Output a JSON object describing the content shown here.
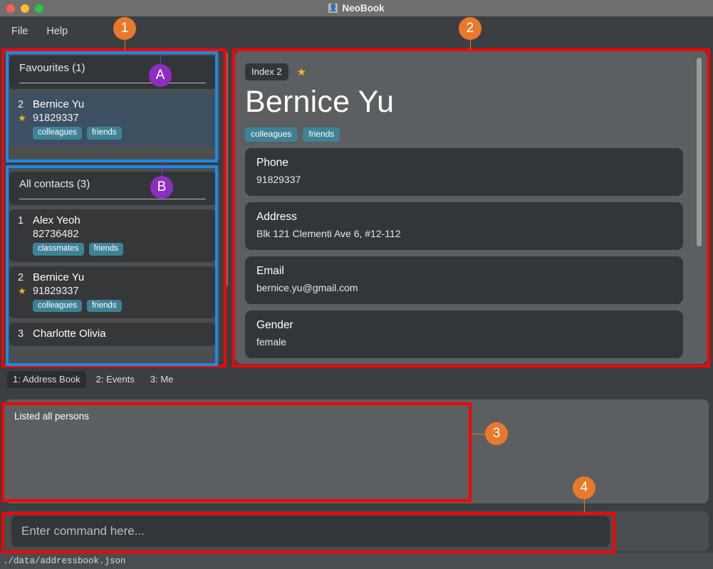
{
  "window": {
    "title": "NeoBook",
    "title_icon": "person-icon",
    "traffic_lights": [
      "close",
      "minimize",
      "maximize"
    ]
  },
  "menubar": {
    "items": [
      {
        "label": "File",
        "name": "menu-file"
      },
      {
        "label": "Help",
        "name": "menu-help"
      }
    ]
  },
  "favourites_panel": {
    "header": "Favourites (1)",
    "contacts": [
      {
        "index": "2",
        "name": "Bernice Yu",
        "phone": "91829337",
        "favourite": true,
        "star_glyph": "★",
        "tags": [
          "colleagues",
          "friends"
        ],
        "selected": true
      }
    ]
  },
  "all_contacts_panel": {
    "header": "All contacts (3)",
    "contacts": [
      {
        "index": "1",
        "name": "Alex Yeoh",
        "phone": "82736482",
        "favourite": false,
        "star_glyph": "★",
        "tags": [
          "classmates",
          "friends"
        ],
        "selected": false
      },
      {
        "index": "2",
        "name": "Bernice Yu",
        "phone": "91829337",
        "favourite": true,
        "star_glyph": "★",
        "tags": [
          "colleagues",
          "friends"
        ],
        "selected": false
      },
      {
        "index": "3",
        "name": "Charlotte Olivia",
        "phone": "",
        "favourite": false,
        "star_glyph": "★",
        "tags": [],
        "selected": false
      }
    ]
  },
  "detail_panel": {
    "index_chip": "Index 2",
    "favourite_star": "★",
    "name": "Bernice Yu",
    "tags": [
      "colleagues",
      "friends"
    ],
    "fields": [
      {
        "label": "Phone",
        "value": "91829337"
      },
      {
        "label": "Address",
        "value": "Blk 121 Clementi Ave 6, #12-112"
      },
      {
        "label": "Email",
        "value": "bernice.yu@gmail.com"
      },
      {
        "label": "Gender",
        "value": "female"
      }
    ]
  },
  "tabs": [
    {
      "label": "1: Address Book",
      "active": true
    },
    {
      "label": "2: Events",
      "active": false
    },
    {
      "label": "3: Me",
      "active": false
    }
  ],
  "result_box": {
    "text": "Listed all persons"
  },
  "command_box": {
    "placeholder": "Enter command here...",
    "value": ""
  },
  "statusbar": {
    "path": "./data/addressbook.json"
  },
  "annotations": {
    "badges": [
      {
        "label": "1",
        "color": "#e8792b"
      },
      {
        "label": "2",
        "color": "#e8792b"
      },
      {
        "label": "3",
        "color": "#e8792b"
      },
      {
        "label": "4",
        "color": "#e8792b"
      },
      {
        "label": "A",
        "color": "#8e2ec0"
      },
      {
        "label": "B",
        "color": "#8e2ec0"
      }
    ],
    "box_colors": {
      "red": "#ff0000",
      "blue": "#1e88e5"
    }
  },
  "colors": {
    "window_chrome": "#6e6e6e",
    "app_background": "#3c3f41",
    "card_background": "#333638",
    "panel_background": "#5c5f61",
    "selected_item": "#3d5062",
    "tag": "#3f8296",
    "star": "#f5b21a",
    "annotation_orange": "#e8792b",
    "annotation_purple": "#8e2ec0"
  }
}
